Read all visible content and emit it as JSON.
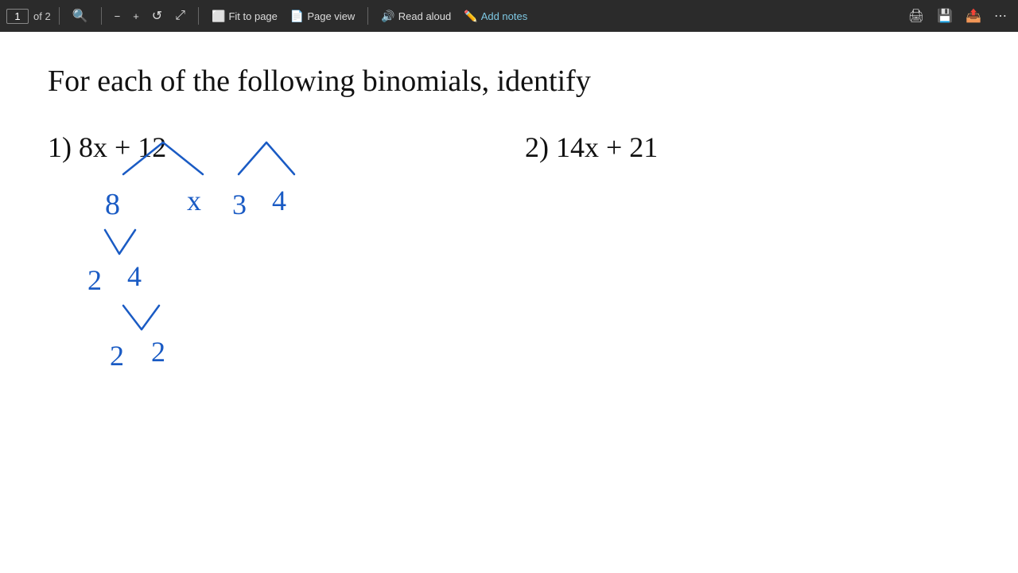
{
  "toolbar": {
    "page_number": "1",
    "of_label": "of 2",
    "zoom_out_label": "−",
    "zoom_in_label": "+",
    "rotate_label": "↺",
    "expand_label": "⤢",
    "fit_to_page_label": "Fit to page",
    "page_view_label": "Page view",
    "read_aloud_label": "Read aloud",
    "add_notes_label": "Add notes",
    "print_icon": "🖨",
    "save_icon": "💾",
    "share_icon": "📤"
  },
  "content": {
    "title": "For each of the following binomials, identify",
    "problem1": "1) 8x + 12",
    "problem2": "2) 14x + 21"
  }
}
